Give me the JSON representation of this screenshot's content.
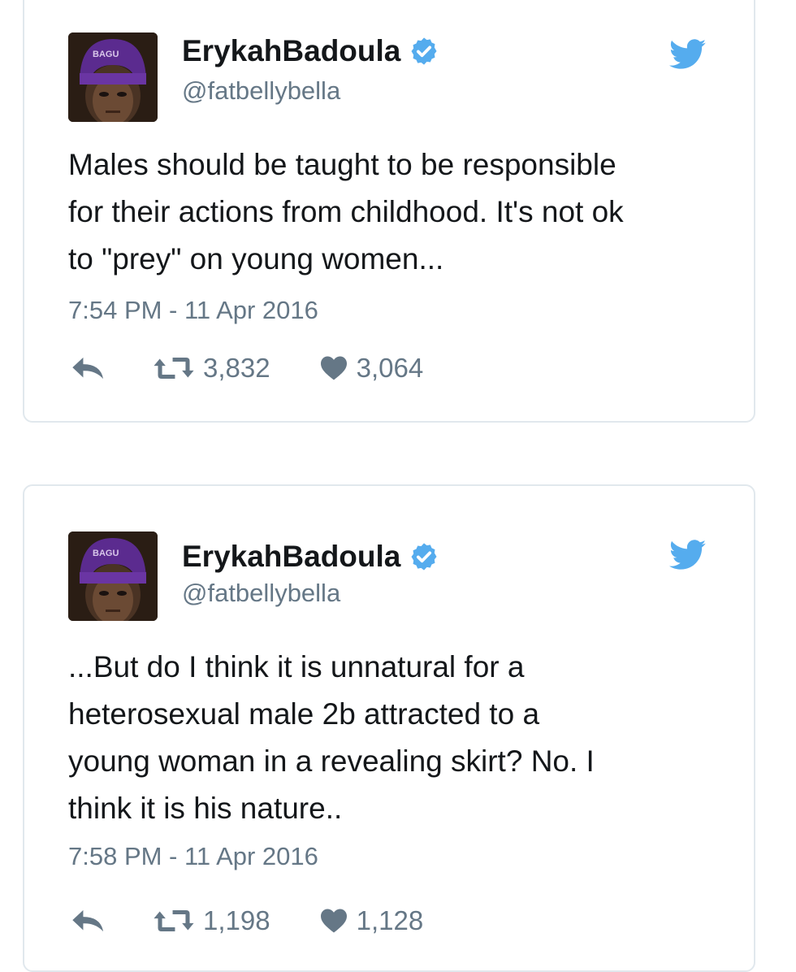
{
  "colors": {
    "text": "#14171a",
    "muted": "#657786",
    "border": "#e1e8ed",
    "twitter_blue": "#55acee",
    "beanie_purple": "#5b2b8f"
  },
  "icons": {
    "verified": "verified-badge-icon",
    "bird": "twitter-bird-icon",
    "reply": "reply-arrow-icon",
    "retweet": "retweet-icon",
    "like": "heart-icon"
  },
  "tweets": [
    {
      "display_name": "ErykahBadoula",
      "handle": "@fatbellybella",
      "text": "Males should be taught to be responsible\nfor their actions from childhood. It's not ok\nto \"prey\" on young women...",
      "timestamp": "7:54 PM - 11 Apr 2016",
      "retweets": "3,832",
      "likes": "3,064"
    },
    {
      "display_name": "ErykahBadoula",
      "handle": "@fatbellybella",
      "text": "...But do I think it is unnatural for a\nheterosexual male 2b attracted to a\nyoung woman in a revealing skirt? No. I\nthink it is his nature..",
      "timestamp": "7:58 PM - 11 Apr 2016",
      "retweets": "1,198",
      "likes": "1,128"
    }
  ]
}
